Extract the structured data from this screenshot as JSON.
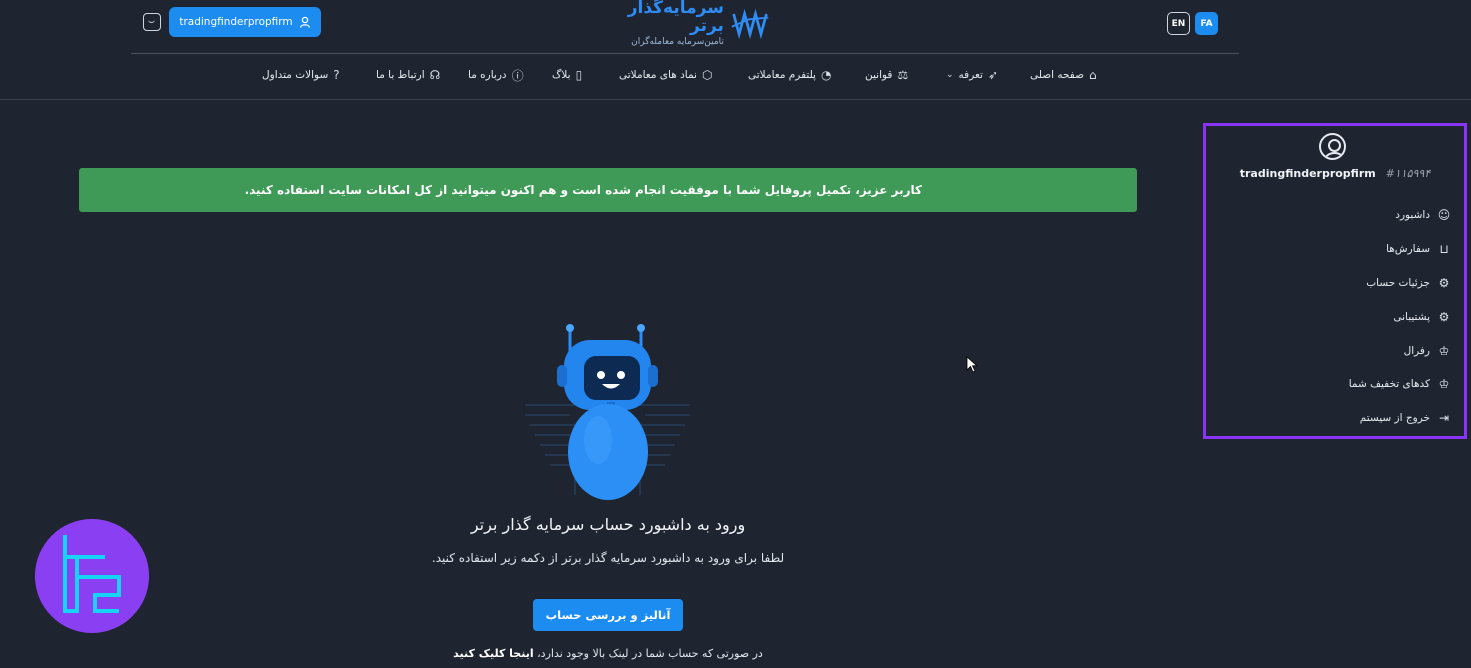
{
  "header": {
    "user_button_label": "tradingfinderpropfirm",
    "logo_title": "سرمایه‌گذار برتر",
    "logo_subtitle": "تامین‌سرمایه معامله‌گران",
    "lang_en": "EN",
    "lang_fa": "FA"
  },
  "nav": [
    {
      "label": "صفحه اصلی",
      "icon": "home-icon"
    },
    {
      "label": "تعرفه",
      "icon": "rocket-icon"
    },
    {
      "label": "قوانین",
      "icon": "scale-icon"
    },
    {
      "label": "پلتفرم معاملاتی",
      "icon": "gauge-icon"
    },
    {
      "label": "نماد های معاملاتی",
      "icon": "cube-icon"
    },
    {
      "label": "بلاگ",
      "icon": "book-icon"
    },
    {
      "label": "درباره ما",
      "icon": "info-icon"
    },
    {
      "label": "ارتباط با ما",
      "icon": "headphones-icon"
    },
    {
      "label": "سوالات متداول",
      "icon": "question-icon"
    }
  ],
  "alert": {
    "message": "کاربر عزیز، تکمیل پروفایل شما با موفقیت انجام شده است و هم اکنون میتوانید از کل امکانات سایت استفاده کنید."
  },
  "main": {
    "title": "ورود به داشبورد حساب سرمایه گذار برتر",
    "subtitle": "لطفا برای ورود به داشبورد سرمایه گذار برتر از دکمه زیر استفاده کنید.",
    "cta_label": "آنالیز و بررسی حساب",
    "footer_text": "در صورتی که حساب شما در لینک بالا وجود ندارد،",
    "footer_link": "اینجا کلیک کنید"
  },
  "sidebar": {
    "username": "tradingfinderpropfirm",
    "user_id": "#۱۱۵۹۹۴",
    "items": [
      {
        "label": "داشبورد",
        "icon": "user-icon"
      },
      {
        "label": "سفارش‌ها",
        "icon": "cart-icon"
      },
      {
        "label": "جزئیات حساب",
        "icon": "gear-icon"
      },
      {
        "label": "پشتیبانی",
        "icon": "gear-icon"
      },
      {
        "label": "رفرال",
        "icon": "trophy-icon"
      },
      {
        "label": "کدهای تخفیف شما",
        "icon": "trophy-icon"
      },
      {
        "label": "خروج از سیستم",
        "icon": "logout-icon"
      }
    ]
  },
  "colors": {
    "background": "#1f2530",
    "accent": "#1c8cf0",
    "success": "#3e9a56",
    "highlight": "#8a34f5"
  }
}
